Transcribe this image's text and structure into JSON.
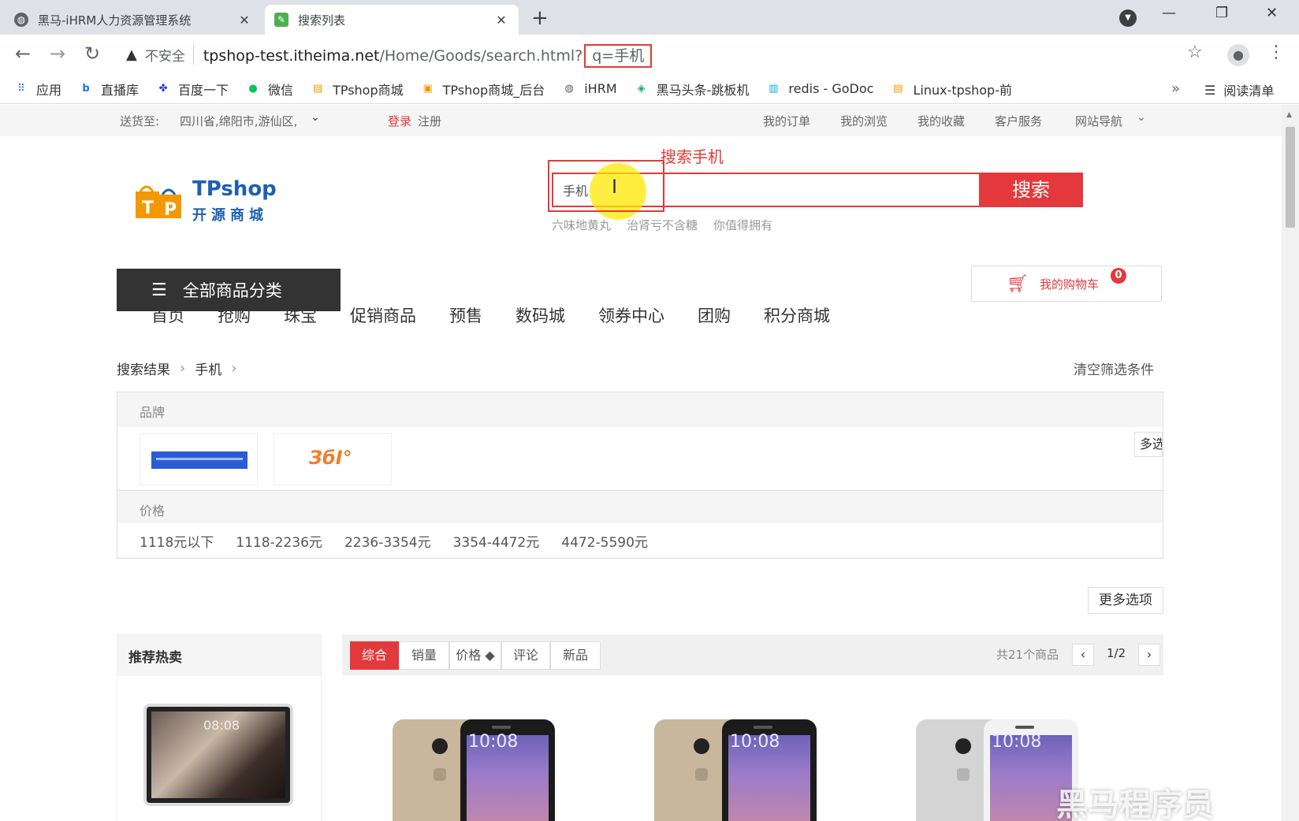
{
  "browser": {
    "tabs": [
      {
        "title": "黑马-iHRM人力资源管理系统",
        "active": false
      },
      {
        "title": "搜索列表",
        "active": true
      }
    ],
    "address": {
      "security_label": "不安全",
      "host": "tpshop-test.itheima.net",
      "path": "/Home/Goods/search.html?",
      "query": "q=手机"
    },
    "bookmarks": [
      {
        "label": "应用",
        "icon": "apps-grid-icon",
        "color": "#1a73e8"
      },
      {
        "label": "直播库",
        "icon": "bilibili-icon",
        "color": "#1a73e8"
      },
      {
        "label": "百度一下",
        "icon": "baidu-paw-icon",
        "color": "#2932e1"
      },
      {
        "label": "微信",
        "icon": "wechat-icon",
        "color": "#07c160"
      },
      {
        "label": "TPshop商城",
        "icon": "tpshop-icon",
        "color": "#f39800"
      },
      {
        "label": "TPshop商城_后台",
        "icon": "tpshop-admin-icon",
        "color": "#f39800"
      },
      {
        "label": "iHRM",
        "icon": "globe-icon",
        "color": "#5f6368"
      },
      {
        "label": "黑马头条-跳板机",
        "icon": "layers-icon",
        "color": "#1fa67a"
      },
      {
        "label": "redis - GoDoc",
        "icon": "godoc-icon",
        "color": "#00add8"
      },
      {
        "label": "Linux-tpshop-前",
        "icon": "tpshop-icon",
        "color": "#f39800"
      }
    ],
    "bookmarks_more": "»",
    "reading_list": "阅读清单"
  },
  "topbar": {
    "ship_to_label": "送货至:",
    "address": "四川省,绵阳市,游仙区,",
    "login": "登录",
    "register": "注册",
    "links": [
      "我的订单",
      "我的浏览",
      "我的收藏",
      "客户服务",
      "网站导航"
    ]
  },
  "header": {
    "logo_brand": "TPshop",
    "logo_sub": "开源商城",
    "annotation": "搜索手机",
    "search_value": "手机",
    "search_button": "搜索",
    "hot_words": [
      "六味地黄丸",
      "治肾亏不含糖",
      "你值得拥有"
    ],
    "cart_label": "我的购物车",
    "cart_count": "0"
  },
  "nav": {
    "all_categories": "全部商品分类",
    "items": [
      "首页",
      "抢购",
      "珠宝",
      "促销商品",
      "预售",
      "数码城",
      "领券中心",
      "团购",
      "积分商城"
    ]
  },
  "breadcrumb": {
    "root": "搜索结果",
    "keyword": "手机",
    "clear": "清空筛选条件"
  },
  "filters": {
    "brand_label": "品牌",
    "brand_more": "多选",
    "price_label": "价格",
    "prices": [
      "1118元以下",
      "1118-2236元",
      "2236-3354元",
      "3354-4472元",
      "4472-5590元"
    ],
    "more_options": "更多选项"
  },
  "recommend": {
    "title": "推荐热卖",
    "tablet_time": "08:08"
  },
  "sort": {
    "tabs": [
      "综合",
      "销量",
      "价格 ◆",
      "评论",
      "新品"
    ],
    "active_index": 0,
    "total": "共21个商品",
    "page": "1/2"
  },
  "products": [
    {
      "time": "10:08",
      "color": "#c8b79c"
    },
    {
      "time": "10:08",
      "color": "#c8b79c"
    },
    {
      "time": "10:08",
      "color": "#d4d4d4"
    }
  ],
  "watermark": "黑马程序员"
}
